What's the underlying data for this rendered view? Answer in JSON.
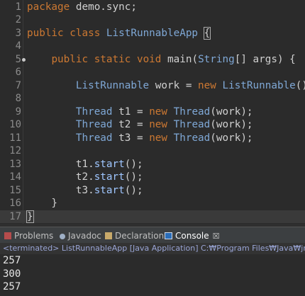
{
  "editor": {
    "lines": [
      {
        "n": "1",
        "parts": [
          [
            "kw",
            "package"
          ],
          [
            "plain",
            " demo.sync;"
          ]
        ]
      },
      {
        "n": "2",
        "parts": []
      },
      {
        "n": "3",
        "parts": [
          [
            "kw",
            "public"
          ],
          [
            "plain",
            " "
          ],
          [
            "kw",
            "class"
          ],
          [
            "plain",
            " "
          ],
          [
            "type",
            "ListRunnableApp"
          ],
          [
            "plain",
            " "
          ],
          [
            "box",
            "{"
          ]
        ]
      },
      {
        "n": "4",
        "parts": []
      },
      {
        "n": "5",
        "parts": [
          [
            "plain",
            "    "
          ],
          [
            "kw",
            "public"
          ],
          [
            "plain",
            " "
          ],
          [
            "kw",
            "static"
          ],
          [
            "plain",
            " "
          ],
          [
            "kw",
            "void"
          ],
          [
            "plain",
            " main("
          ],
          [
            "type",
            "String"
          ],
          [
            "plain",
            "[] args) {"
          ]
        ]
      },
      {
        "n": "6",
        "parts": []
      },
      {
        "n": "7",
        "parts": [
          [
            "plain",
            "        "
          ],
          [
            "type",
            "ListRunnable"
          ],
          [
            "plain",
            " work = "
          ],
          [
            "kw",
            "new"
          ],
          [
            "plain",
            " "
          ],
          [
            "type",
            "ListRunnable"
          ],
          [
            "plain",
            "();"
          ]
        ]
      },
      {
        "n": "8",
        "parts": []
      },
      {
        "n": "9",
        "parts": [
          [
            "plain",
            "        "
          ],
          [
            "type",
            "Thread"
          ],
          [
            "plain",
            " t1 = "
          ],
          [
            "kw",
            "new"
          ],
          [
            "plain",
            " "
          ],
          [
            "type",
            "Thread"
          ],
          [
            "plain",
            "(work);"
          ]
        ]
      },
      {
        "n": "10",
        "parts": [
          [
            "plain",
            "        "
          ],
          [
            "type",
            "Thread"
          ],
          [
            "plain",
            " t2 = "
          ],
          [
            "kw",
            "new"
          ],
          [
            "plain",
            " "
          ],
          [
            "type",
            "Thread"
          ],
          [
            "plain",
            "(work);"
          ]
        ]
      },
      {
        "n": "11",
        "parts": [
          [
            "plain",
            "        "
          ],
          [
            "type",
            "Thread"
          ],
          [
            "plain",
            " t3 = "
          ],
          [
            "kw",
            "new"
          ],
          [
            "plain",
            " "
          ],
          [
            "type",
            "Thread"
          ],
          [
            "plain",
            "(work);"
          ]
        ]
      },
      {
        "n": "12",
        "parts": []
      },
      {
        "n": "13",
        "parts": [
          [
            "plain",
            "        t1."
          ],
          [
            "call",
            "start"
          ],
          [
            "plain",
            "();"
          ]
        ]
      },
      {
        "n": "14",
        "parts": [
          [
            "plain",
            "        t2."
          ],
          [
            "call",
            "start"
          ],
          [
            "plain",
            "();"
          ]
        ]
      },
      {
        "n": "15",
        "parts": [
          [
            "plain",
            "        t3."
          ],
          [
            "call",
            "start"
          ],
          [
            "plain",
            "();"
          ]
        ]
      },
      {
        "n": "16",
        "parts": [
          [
            "plain",
            "    }"
          ]
        ]
      },
      {
        "n": "17",
        "parts": [
          [
            "box",
            "}"
          ]
        ]
      }
    ],
    "current_line": "17",
    "marker_line": "5"
  },
  "panel": {
    "tabs": [
      {
        "label": "Problems",
        "icon": "problems-icon"
      },
      {
        "label": "Javadoc",
        "icon": "javadoc-icon"
      },
      {
        "label": "Declaration",
        "icon": "declaration-icon"
      },
      {
        "label": "Console",
        "icon": "console-icon",
        "active": true
      }
    ],
    "close_glyph": "☒",
    "status": "<terminated> ListRunnableApp [Java Application] C:₩Program Files₩Java₩jre",
    "output": [
      "257",
      "300",
      "257"
    ]
  }
}
